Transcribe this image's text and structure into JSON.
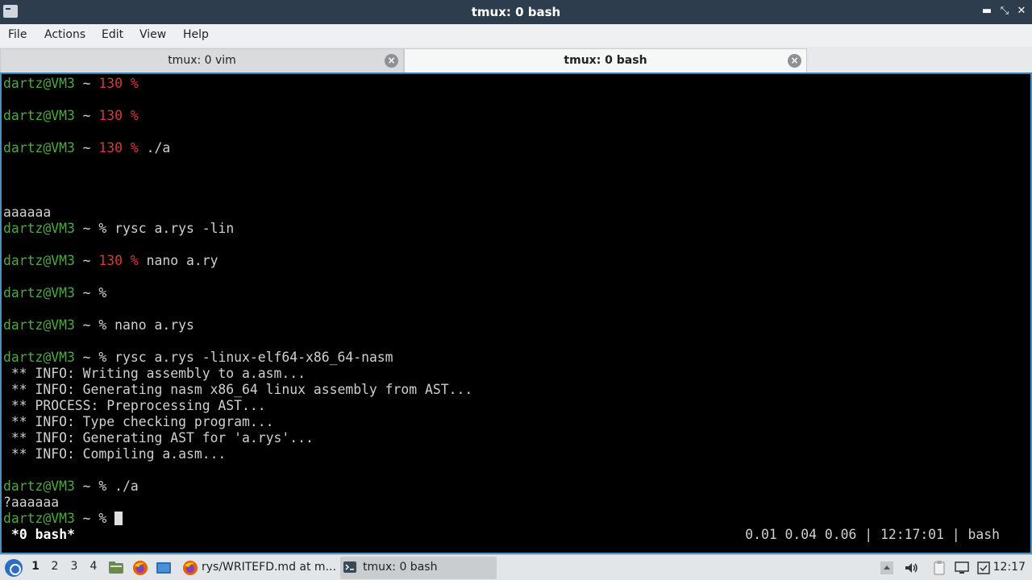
{
  "window": {
    "title": "tmux: 0 bash",
    "controls": {
      "minimize": "▬",
      "maximize": "⤡",
      "close": "✕"
    }
  },
  "menu": [
    "File",
    "Actions",
    "Edit",
    "View",
    "Help"
  ],
  "tabs": [
    {
      "label": "tmux: 0 vim",
      "active": false
    },
    {
      "label": "tmux: 0 bash",
      "active": true
    }
  ],
  "terminal": {
    "prompt_user": "dartz@VM3",
    "lines": [
      {
        "user": "dartz@VM3",
        "sep": " ~ ",
        "code": "130 ",
        "sym": "%",
        "cmd": ""
      },
      {
        "user": "dartz@VM3",
        "sep": " ~ ",
        "code": "130 ",
        "sym": "%",
        "cmd": ""
      },
      {
        "user": "dartz@VM3",
        "sep": " ~ ",
        "code": "130 ",
        "sym": "%",
        "cmd": " ./a"
      },
      {
        "text": "aaaaaa"
      },
      {
        "user": "dartz@VM3",
        "sep": " ~ ",
        "code": "",
        "sym": "%",
        "cmd": " rysc a.rys -lin"
      },
      {
        "user": "dartz@VM3",
        "sep": " ~ ",
        "code": "130 ",
        "sym": "%",
        "cmd": " nano a.ry"
      },
      {
        "user": "dartz@VM3",
        "sep": " ~ ",
        "code": "",
        "sym": "%",
        "cmd": ""
      },
      {
        "user": "dartz@VM3",
        "sep": " ~ ",
        "code": "",
        "sym": "%",
        "cmd": " nano a.rys"
      },
      {
        "user": "dartz@VM3",
        "sep": " ~ ",
        "code": "",
        "sym": "%",
        "cmd": " rysc a.rys -linux-elf64-x86_64-nasm"
      },
      {
        "text": " ** INFO: Writing assembly to a.asm..."
      },
      {
        "text": " ** INFO: Generating nasm x86_64 linux assembly from AST..."
      },
      {
        "text": " ** PROCESS: Preprocessing AST..."
      },
      {
        "text": " ** INFO: Type checking program..."
      },
      {
        "text": " ** INFO: Generating AST for 'a.rys'..."
      },
      {
        "text": " ** INFO: Compiling a.asm..."
      },
      {
        "user": "dartz@VM3",
        "sep": " ~ ",
        "code": "",
        "sym": "%",
        "cmd": " ./a"
      },
      {
        "text": "?aaaaaa"
      },
      {
        "user": "dartz@VM3",
        "sep": " ~ ",
        "code": "",
        "sym": "%",
        "cmd": " "
      }
    ],
    "status_left": "*0 bash*",
    "status_right": "0.01 0.04 0.06 | 12:17:01 | bash"
  },
  "taskbar": {
    "workspaces": [
      "1",
      "2",
      "3",
      "4"
    ],
    "tasks": [
      {
        "label": "rys/WRITEFD.md at m...",
        "icon": "firefox-icon",
        "active": false
      },
      {
        "label": "tmux: 0 bash",
        "icon": "terminal-icon",
        "active": true
      }
    ],
    "clock": "12:17"
  },
  "colors": {
    "prompt_user": "#4fa843",
    "exit_code": "#d23a3a",
    "terminal_bg": "#000000",
    "title_bg": "#2d3d4d"
  }
}
